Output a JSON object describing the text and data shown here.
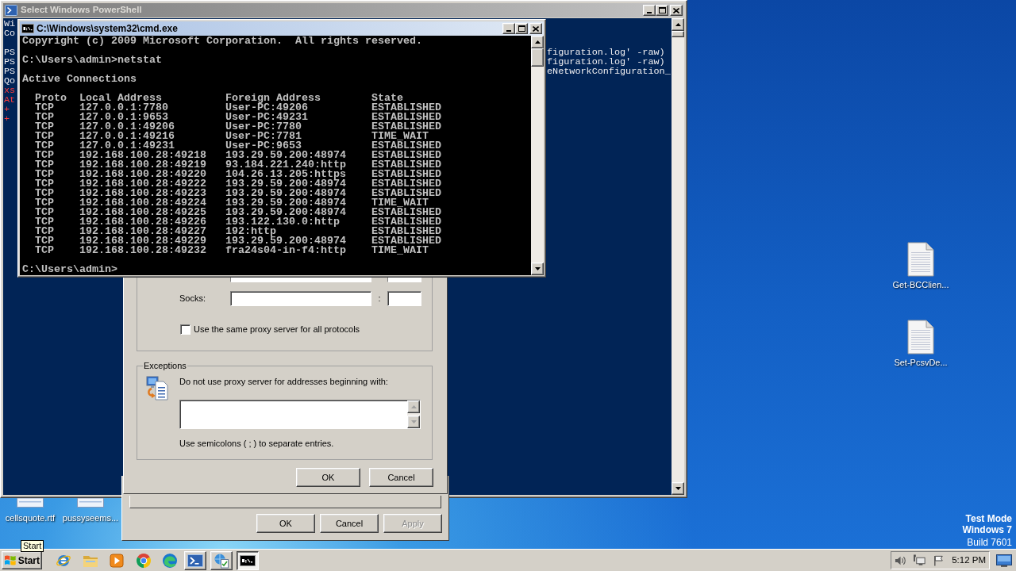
{
  "powershell_window": {
    "title": "Select Windows PowerShell",
    "active": false,
    "banner_lines": [
      "Wi",
      "Co"
    ],
    "lines": [
      {
        "kind": "output",
        "left": "PS",
        "right": "figuration.log' -raw)"
      },
      {
        "kind": "output",
        "left": "PS",
        "right": "figuration.log' -raw)"
      },
      {
        "kind": "output",
        "left": "PS",
        "right": "eNetworkConfiguration_"
      },
      {
        "kind": "output",
        "left": "Qo"
      },
      {
        "kind": "error",
        "left": "xs"
      },
      {
        "kind": "error",
        "left": "At"
      },
      {
        "kind": "error",
        "left": "+"
      },
      {
        "kind": "error",
        "left": "+"
      }
    ]
  },
  "cmd_window": {
    "title": "C:\\Windows\\system32\\cmd.exe",
    "active": true,
    "copyright": "Copyright (c) 2009 Microsoft Corporation.  All rights reserved.",
    "command": "C:\\Users\\admin>netstat",
    "heading": "Active Connections",
    "table": {
      "columns": [
        "Proto",
        "Local Address",
        "Foreign Address",
        "State"
      ],
      "rows": [
        [
          "TCP",
          "127.0.0.1:7780",
          "User-PC:49206",
          "ESTABLISHED"
        ],
        [
          "TCP",
          "127.0.0.1:9653",
          "User-PC:49231",
          "ESTABLISHED"
        ],
        [
          "TCP",
          "127.0.0.1:49206",
          "User-PC:7780",
          "ESTABLISHED"
        ],
        [
          "TCP",
          "127.0.0.1:49216",
          "User-PC:7781",
          "TIME_WAIT"
        ],
        [
          "TCP",
          "127.0.0.1:49231",
          "User-PC:9653",
          "ESTABLISHED"
        ],
        [
          "TCP",
          "192.168.100.28:49218",
          "193.29.59.200:48974",
          "ESTABLISHED"
        ],
        [
          "TCP",
          "192.168.100.28:49219",
          "93.184.221.240:http",
          "ESTABLISHED"
        ],
        [
          "TCP",
          "192.168.100.28:49220",
          "104.26.13.205:https",
          "ESTABLISHED"
        ],
        [
          "TCP",
          "192.168.100.28:49222",
          "193.29.59.200:48974",
          "ESTABLISHED"
        ],
        [
          "TCP",
          "192.168.100.28:49223",
          "193.29.59.200:48974",
          "ESTABLISHED"
        ],
        [
          "TCP",
          "192.168.100.28:49224",
          "193.29.59.200:48974",
          "TIME_WAIT"
        ],
        [
          "TCP",
          "192.168.100.28:49225",
          "193.29.59.200:48974",
          "ESTABLISHED"
        ],
        [
          "TCP",
          "192.168.100.28:49226",
          "193.122.130.0:http",
          "ESTABLISHED"
        ],
        [
          "TCP",
          "192.168.100.28:49227",
          "192:http",
          "ESTABLISHED"
        ],
        [
          "TCP",
          "192.168.100.28:49229",
          "193.29.59.200:48974",
          "ESTABLISHED"
        ],
        [
          "TCP",
          "192.168.100.28:49232",
          "fra24s04-in-f4:http",
          "TIME_WAIT"
        ]
      ]
    },
    "prompt": "C:\\Users\\admin>"
  },
  "proxy_dialog": {
    "server_rows": [
      {
        "kind": "cut"
      },
      {
        "kind": "full",
        "label": "Socks:",
        "separator": ":"
      }
    ],
    "same_proxy": {
      "label": "Use the same proxy server for all protocols",
      "checked": false
    },
    "exceptions": {
      "legend": "Exceptions",
      "instruction": "Do not use proxy server for addresses beginning with:",
      "hint": "Use semicolons ( ; ) to separate entries."
    },
    "buttons": [
      {
        "label": "OK"
      },
      {
        "label": "Cancel"
      }
    ]
  },
  "internet_properties": {
    "buttons": [
      {
        "label": "OK",
        "disabled": false
      },
      {
        "label": "Cancel",
        "disabled": false
      },
      {
        "label": "Apply",
        "disabled": true
      }
    ]
  },
  "desktop_icons_right": [
    {
      "label": "Get-BCClien..."
    },
    {
      "label": "Set-PcsvDe..."
    }
  ],
  "desktop_icons_bottom": [
    {
      "label": "cellsquote.rtf"
    },
    {
      "label": "pussyseems..."
    }
  ],
  "edition_notice": [
    {
      "kind": "heading",
      "text": "Test Mode"
    },
    {
      "kind": "heading",
      "text": "Windows 7"
    },
    {
      "kind": "detail",
      "text": "Build 7601"
    }
  ],
  "start_tooltip": {
    "text": "Start"
  },
  "taskbar": {
    "start": "Start",
    "quick_launch": [
      {
        "kind": "ie"
      },
      {
        "kind": "folder"
      },
      {
        "kind": "media"
      },
      {
        "kind": "chrome"
      },
      {
        "kind": "edge"
      }
    ],
    "tasks": [
      {
        "kind": "powershell",
        "selected": false
      },
      {
        "kind": "network",
        "selected": false
      },
      {
        "kind": "cmd",
        "selected": true
      }
    ],
    "clock": "5:12 PM"
  }
}
